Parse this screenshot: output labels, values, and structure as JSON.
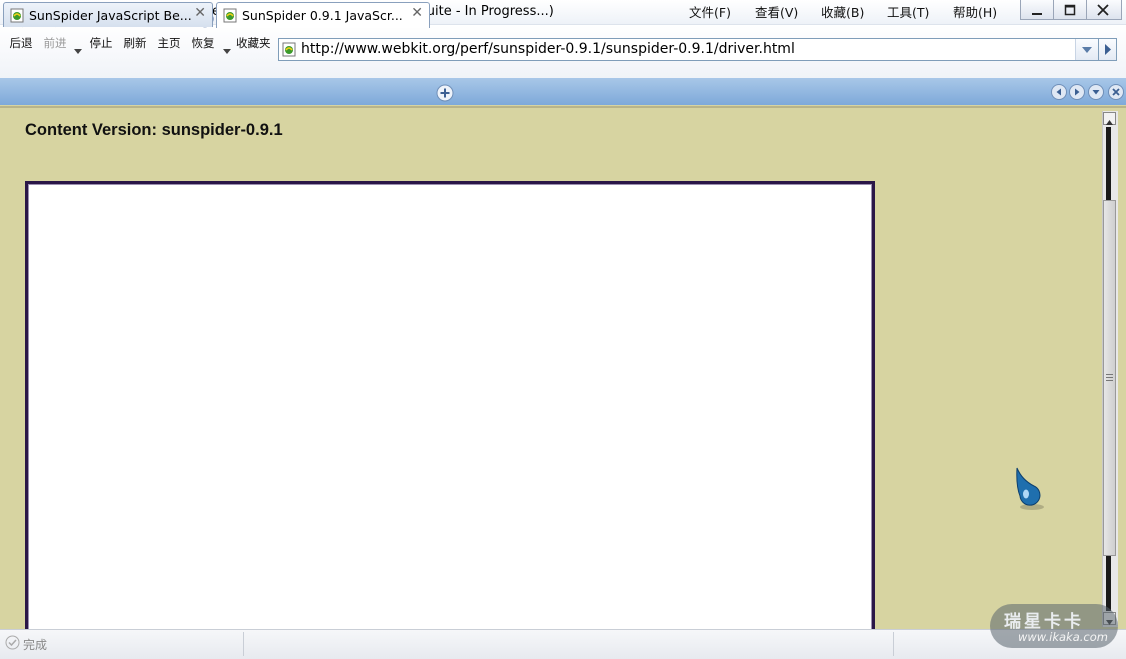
{
  "window": {
    "title": "SunSpider 0.9.1 JavaScript Benchmark (sunspider-0.9.1 test suite - In Progress...)",
    "menu": [
      "文件(F)",
      "查看(V)",
      "收藏(B)",
      "工具(T)",
      "帮助(H)"
    ]
  },
  "toolbar": {
    "back_label": "后退",
    "forward_label": "前进",
    "stop_label": "停止",
    "refresh_label": "刷新",
    "home_label": "主页",
    "restore_label": "恢复",
    "favorites_label": "收藏夹"
  },
  "address": {
    "url": "http://www.webkit.org/perf/sunspider-0.9.1/sunspider-0.9.1/driver.html"
  },
  "tabs": [
    {
      "title": "SunSpider JavaScript Be...",
      "active": false
    },
    {
      "title": "SunSpider 0.9.1 JavaScr...",
      "active": true
    }
  ],
  "page": {
    "content_version": "Content Version: sunspider-0.9.1"
  },
  "status": {
    "text": "完成"
  },
  "watermark": {
    "cn": "瑞星卡卡",
    "url": "www.ikaka.com"
  },
  "colors": {
    "page_background": "#d7d4a1",
    "tab_bar": "#7ea9d9",
    "frame_border": "#2a1647"
  },
  "icons": {
    "back": "arrow-left-icon",
    "forward": "arrow-right-icon",
    "stop": "stop-icon",
    "refresh": "refresh-icon",
    "home": "home-icon",
    "restore": "undo-icon",
    "favorites": "star-icon"
  }
}
